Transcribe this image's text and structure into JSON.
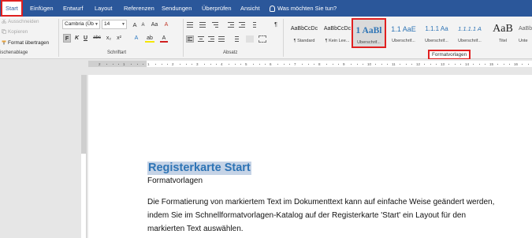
{
  "tabs": {
    "start": "Start",
    "einfuegen": "Einfügen",
    "entwurf": "Entwurf",
    "layout": "Layout",
    "referenzen": "Referenzen",
    "sendungen": "Sendungen",
    "ueberpruefen": "Überprüfen",
    "ansicht": "Ansicht",
    "tell_me": "Was möchten Sie tun?"
  },
  "clipboard": {
    "cut": "Ausschneiden",
    "copy": "Kopieren",
    "format_painter": "Format übertragen",
    "group_label": "ischenablage"
  },
  "font": {
    "name": "Cambria (Üb",
    "size": "14",
    "group_label": "Schriftart",
    "buttons": {
      "bold": "F",
      "italic": "K",
      "underline": "U",
      "strike": "abc",
      "sub": "x₂",
      "sup": "x²",
      "grow": "A",
      "shrink": "A",
      "case": "Aa",
      "clear": "A",
      "effects": "A",
      "highlight": "ab",
      "color": "A"
    }
  },
  "paragraph": {
    "group_label": "Absatz",
    "pilcrow": "¶"
  },
  "styles": {
    "group_label": "Formatvorlagen",
    "items": [
      {
        "preview": "AaBbCcDc",
        "name": "¶ Standard"
      },
      {
        "preview": "AaBbCcDc",
        "name": "¶ Kein Lee..."
      },
      {
        "preview": "1 AaBl",
        "name": "Überschrif..."
      },
      {
        "preview": "1.1 AaE",
        "name": "Überschrif..."
      },
      {
        "preview": "1.1.1 Aa",
        "name": "Überschrif..."
      },
      {
        "preview": "1.1.1.1 A",
        "name": "Überschrif..."
      },
      {
        "preview": "AaB",
        "name": "Titel"
      },
      {
        "preview": "AaBbCc",
        "name": "Unte"
      }
    ]
  },
  "ruler": {
    "marks": [
      "2",
      "1",
      "1",
      "2",
      "3",
      "4",
      "5",
      "6",
      "7",
      "8",
      "9",
      "10",
      "11",
      "12",
      "13",
      "14",
      "15",
      "16",
      "17"
    ]
  },
  "document": {
    "heading": "Registerkarte Start",
    "subtitle": "Formatvorlagen",
    "body": [
      "Die Formatierung von markiertem Text im Dokumenttext kann auf einfache Weise geändert werden,",
      "indem Sie im Schnellformatvorlagen-Katalog auf der Registerkarte 'Start' ein Layout für den",
      "markierten Text auswählen."
    ]
  },
  "colors": {
    "ribbon_blue": "#2b579a",
    "heading_blue": "#2e74b5",
    "highlight_red": "#e02020"
  }
}
